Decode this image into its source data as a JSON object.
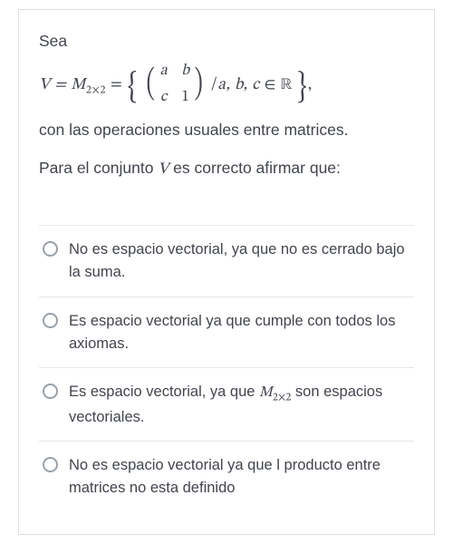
{
  "prompt": {
    "intro": "Sea",
    "line1_lhs": "V = M",
    "line1_sub": "2×2",
    "line1_eq": " = ",
    "matrix": {
      "a": "a",
      "b": "b",
      "c": "c",
      "d": "1"
    },
    "line1_cond_prefix": " /",
    "line1_cond_vars": "a, b, c",
    "line1_cond_in": " ∈ ",
    "line1_cond_set": "ℝ",
    "line1_tail": ",",
    "line2": "con las operaciones usuales entre matrices.",
    "question_pre": "Para el conjunto ",
    "question_var": "V",
    "question_post": " es correcto afirmar que:"
  },
  "options": [
    {
      "text": "No es espacio vectorial, ya que no es cerrado bajo la suma."
    },
    {
      "text": "Es espacio vectorial ya que cumple con todos los axiomas."
    },
    {
      "pre": "Es espacio vectorial, ya que ",
      "math": "M",
      "mathsub": "2×2",
      "post": " son espacios vectoriales."
    },
    {
      "text": "No es espacio vectorial ya que l producto entre matrices no esta definido"
    }
  ]
}
